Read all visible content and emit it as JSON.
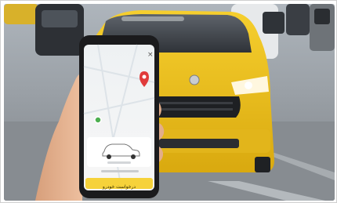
{
  "scene": {
    "description_label": "",
    "phone_app": {
      "close_glyph": "×",
      "map_pin_color": "#e03b3b",
      "accent_color": "#f6d23a",
      "location_dot_color": "#4caf50",
      "bottom_button_label": "درخواست خودرو",
      "vehicle_label": "",
      "small_caption": ""
    },
    "colors": {
      "taxi_yellow": "#f2c21c",
      "road": "#8f9499",
      "sky": "#b9c0c7",
      "phone_body": "#1b1b1d",
      "skin": "#e9b896"
    }
  }
}
